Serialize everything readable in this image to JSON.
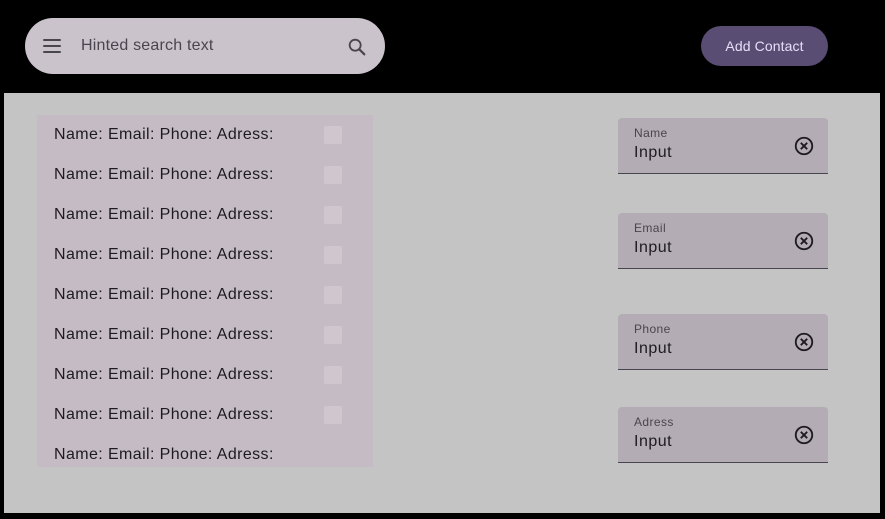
{
  "header": {
    "search": {
      "placeholder": "Hinted search text",
      "menu_icon": "menu-icon",
      "search_icon": "search-icon"
    },
    "add_button_label": "Add Contact"
  },
  "contacts": {
    "items": [
      {
        "label": "Name: Email: Phone: Adress:"
      },
      {
        "label": "Name: Email: Phone: Adress:"
      },
      {
        "label": "Name: Email: Phone: Adress:"
      },
      {
        "label": "Name: Email: Phone: Adress:"
      },
      {
        "label": "Name: Email: Phone: Adress:"
      },
      {
        "label": "Name: Email: Phone: Adress:"
      },
      {
        "label": "Name: Email: Phone: Adress:"
      },
      {
        "label": "Name: Email: Phone: Adress:"
      },
      {
        "label": "Name: Email: Phone: Adress:"
      }
    ]
  },
  "form": {
    "name": {
      "label": "Name",
      "value": "Input"
    },
    "email": {
      "label": "Email",
      "value": "Input"
    },
    "phone": {
      "label": "Phone",
      "value": "Input"
    },
    "address": {
      "label": "Adress",
      "value": "Input"
    }
  },
  "colors": {
    "background": "#000000",
    "content": "#c4c4c4",
    "accent": "#5a4d73",
    "list_bg": "#c5bbc4",
    "field_bg": "#b3acb4"
  }
}
